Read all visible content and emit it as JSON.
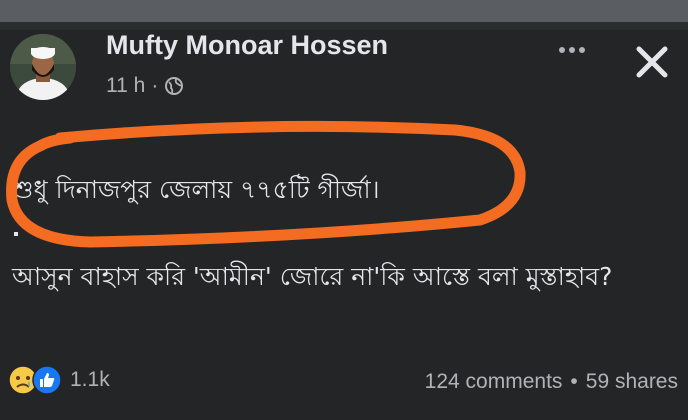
{
  "post": {
    "author": "Mufty Monoar Hossen",
    "time": "11 h",
    "separator": "·",
    "text_line1": "শুধু দিনাজপুর জেলায় ৭৭৫টি গীর্জা।",
    "text_line2": "আসুন বাহাস করি 'আমীন' জোরে না'কি আস্তে বলা মুস্তাহাব?",
    "reactions_count": "1.1k",
    "comments": "124 comments",
    "stats_separator": "•",
    "shares": "59 shares",
    "reaction_icons": [
      "sad-face-icon",
      "like-icon"
    ],
    "annotation_color": "#f36c21"
  },
  "icons": {
    "privacy": "globe-icon",
    "more": "more-options-icon",
    "close": "close-icon"
  }
}
